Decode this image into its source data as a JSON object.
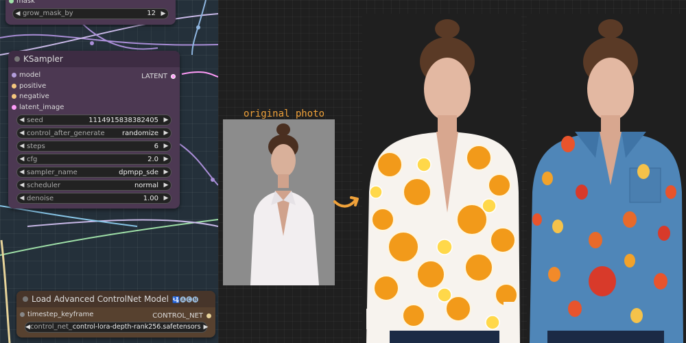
{
  "top_node": {
    "partial_label": "mask",
    "widget": {
      "label": "grow_mask_by",
      "value": "12"
    }
  },
  "ksampler": {
    "title": "KSampler",
    "inputs": [
      "model",
      "positive",
      "negative",
      "latent_image"
    ],
    "output": "LATENT",
    "widgets": [
      {
        "label": "seed",
        "value": "1114915838382405"
      },
      {
        "label": "control_after_generate",
        "value": "randomize"
      },
      {
        "label": "steps",
        "value": "6"
      },
      {
        "label": "cfg",
        "value": "2.0"
      },
      {
        "label": "sampler_name",
        "value": "dpmpp_sde"
      },
      {
        "label": "scheduler",
        "value": "normal"
      },
      {
        "label": "denoise",
        "value": "1.00"
      }
    ]
  },
  "controlnet": {
    "title": "Load Advanced ControlNet Model",
    "badge": "🛂🅐🅒🅝",
    "input": "timestep_keyframe",
    "output": "CONTROL_NET",
    "widget": {
      "label": "control_net_name",
      "value": "control-lora-depth-rank256.safetensors"
    }
  },
  "photos": {
    "original_label": "original photo"
  },
  "colors": {
    "node_body": "#4c3852",
    "node_title": "#3d2c43",
    "accent_arrow": "#f0a23a",
    "socket_model": "#b39ddb",
    "socket_positive": "#f5c77e",
    "socket_latent": "#ff9cf9"
  }
}
